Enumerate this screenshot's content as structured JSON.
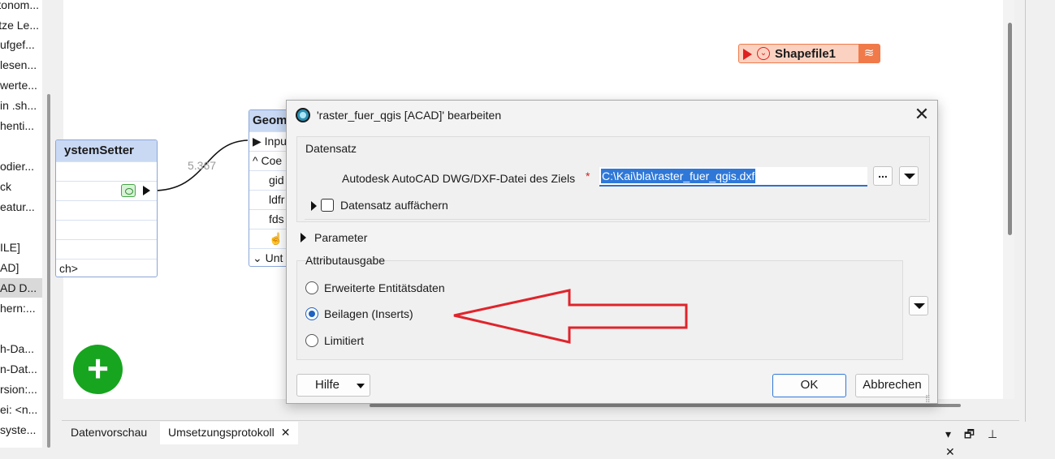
{
  "navigator": {
    "items": [
      {
        "label": "Ontonom..."
      },
      {
        "label": "tze Le..."
      },
      {
        "label": "ufgef..."
      },
      {
        "label": "lesen..."
      },
      {
        "label": "werte..."
      },
      {
        "label": "in .sh..."
      },
      {
        "label": "henti..."
      },
      {
        "label": ""
      },
      {
        "label": "odier..."
      },
      {
        "label": "ck"
      },
      {
        "label": "eatur..."
      },
      {
        "label": ""
      },
      {
        "label": "ILE]"
      },
      {
        "label": "AD]"
      },
      {
        "label": "AD D..."
      },
      {
        "label": "hern:..."
      },
      {
        "label": ""
      },
      {
        "label": "h-Da..."
      },
      {
        "label": "n-Dat..."
      },
      {
        "label": "rsion:..."
      },
      {
        "label": "ei: <n..."
      },
      {
        "label": "syste..."
      }
    ],
    "selected_index": 14
  },
  "canvas": {
    "css_node": {
      "title": "ystemSetter",
      "rows": [
        "",
        "",
        "",
        "",
        "",
        "ch>"
      ]
    },
    "connection_count": "5.367",
    "geom_node": {
      "title": "Geom",
      "rows": [
        "Inpu",
        "Coe",
        "gid",
        "ldfr",
        "fds",
        "",
        "Unt"
      ],
      "row_icons": [
        "▶",
        "^",
        "",
        "",
        "",
        "☝",
        "⌄"
      ]
    },
    "shapefile": {
      "label": "Shapefile1",
      "play_icon": "play-icon",
      "stack_icon": "layers-icon",
      "color": "#f07a4a"
    },
    "add_button_label": "+"
  },
  "dialog": {
    "title": "'raster_fuer_qgis [ACAD]' bearbeiten",
    "close_label": "✕",
    "datensatz_group": "Datensatz",
    "target_label": "Autodesk AutoCAD DWG/DXF-Datei des Ziels",
    "required_marker": "*",
    "target_value": "C:\\Kai\\bla\\raster_fuer_qgis.dxf",
    "browse_label": "...",
    "expand_label": "Datensatz auffächern",
    "parameter_label": "Parameter",
    "attr_group": "Attributausgabe",
    "options": [
      {
        "label": "Erweiterte Entitätsdaten",
        "selected": false
      },
      {
        "label": "Beilagen (Inserts)",
        "selected": true
      },
      {
        "label": "Limitiert",
        "selected": false
      }
    ],
    "help_label": "Hilfe",
    "ok_label": "OK",
    "cancel_label": "Abbrechen",
    "annotation_arrow_color": "#e0242b",
    "accent_color": "#2f78d8"
  },
  "bottom_panel": {
    "tabs": [
      {
        "label": "Datenvorschau"
      },
      {
        "label": "Umsetzungsprotokoll"
      }
    ],
    "tab_close": "✕",
    "tools": "▾ 🗗 ⊥ ✕"
  }
}
